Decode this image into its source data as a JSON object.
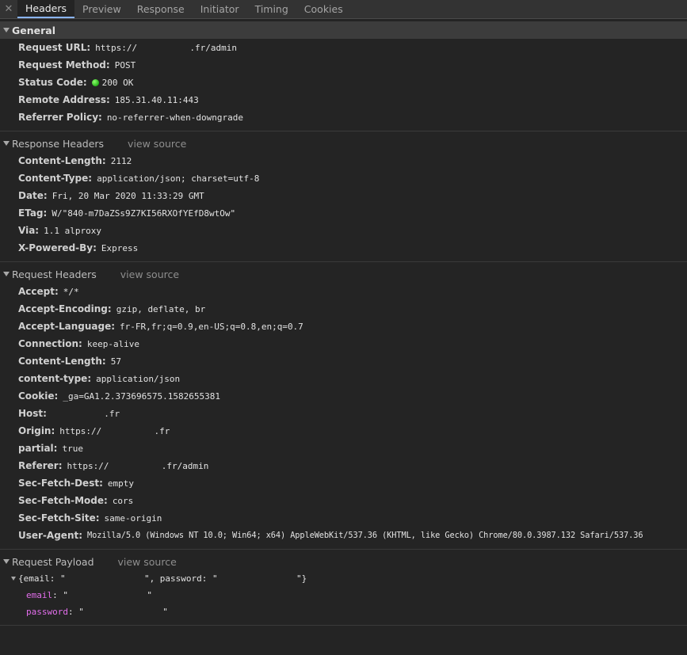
{
  "tabs": {
    "close": "✕",
    "items": [
      "Headers",
      "Preview",
      "Response",
      "Initiator",
      "Timing",
      "Cookies"
    ]
  },
  "general": {
    "title": "General",
    "rows": [
      {
        "key": "Request URL:",
        "value": "https://          .fr/admin"
      },
      {
        "key": "Request Method:",
        "value": "POST"
      },
      {
        "key": "Status Code:",
        "value": "200 OK"
      },
      {
        "key": "Remote Address:",
        "value": "185.31.40.11:443"
      },
      {
        "key": "Referrer Policy:",
        "value": "no-referrer-when-downgrade"
      }
    ]
  },
  "response_headers": {
    "title": "Response Headers",
    "view_source": "view source",
    "rows": [
      {
        "key": "Content-Length:",
        "value": "2112"
      },
      {
        "key": "Content-Type:",
        "value": "application/json; charset=utf-8"
      },
      {
        "key": "Date:",
        "value": "Fri, 20 Mar 2020 11:33:29 GMT"
      },
      {
        "key": "ETag:",
        "value": "W/\"840-m7DaZSs9Z7KI56RXOfYEfD8wtOw\""
      },
      {
        "key": "Via:",
        "value": "1.1 alproxy"
      },
      {
        "key": "X-Powered-By:",
        "value": "Express"
      }
    ]
  },
  "request_headers": {
    "title": "Request Headers",
    "view_source": "view source",
    "rows": [
      {
        "key": "Accept:",
        "value": "*/*"
      },
      {
        "key": "Accept-Encoding:",
        "value": "gzip, deflate, br"
      },
      {
        "key": "Accept-Language:",
        "value": "fr-FR,fr;q=0.9,en-US;q=0.8,en;q=0.7"
      },
      {
        "key": "Connection:",
        "value": "keep-alive"
      },
      {
        "key": "Content-Length:",
        "value": "57"
      },
      {
        "key": "content-type:",
        "value": "application/json"
      },
      {
        "key": "Cookie:",
        "value": "_ga=GA1.2.373696575.1582655381"
      },
      {
        "key": "Host:",
        "value": "          .fr"
      },
      {
        "key": "Origin:",
        "value": "https://          .fr"
      },
      {
        "key": "partial:",
        "value": "true"
      },
      {
        "key": "Referer:",
        "value": "https://          .fr/admin"
      },
      {
        "key": "Sec-Fetch-Dest:",
        "value": "empty"
      },
      {
        "key": "Sec-Fetch-Mode:",
        "value": "cors"
      },
      {
        "key": "Sec-Fetch-Site:",
        "value": "same-origin"
      },
      {
        "key": "User-Agent:",
        "value": "Mozilla/5.0 (Windows NT 10.0; Win64; x64) AppleWebKit/537.36 (KHTML, like Gecko) Chrome/80.0.3987.132 Safari/537.36"
      }
    ]
  },
  "request_payload": {
    "title": "Request Payload",
    "view_source": "view source",
    "root": "{email: \"               \", password: \"               \"}",
    "fields": [
      {
        "key": "email",
        "value": "\"               \""
      },
      {
        "key": "password",
        "value": "\"               \""
      }
    ]
  }
}
